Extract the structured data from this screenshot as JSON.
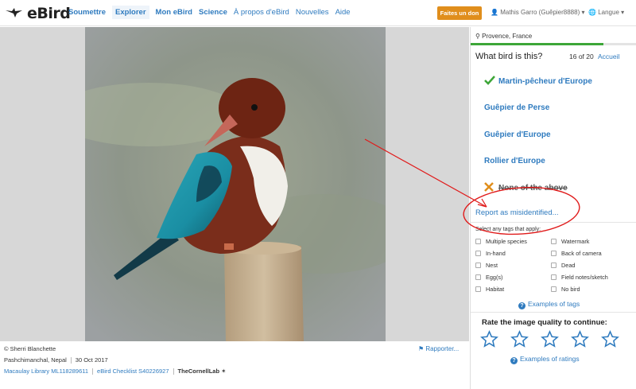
{
  "header": {
    "logo_text": "eBird",
    "nav": [
      "Soumettre",
      "Explorer",
      "Mon eBird",
      "Science",
      "À propos d'eBird",
      "Nouvelles",
      "Aide"
    ],
    "donate_label": "Faites un don",
    "user_label": "Mathis Garro (Guêpier8888)",
    "language_label": "Langue"
  },
  "photo": {
    "credit": "© Sherri Blanchette",
    "location": "Pashchimanchal, Nepal",
    "date": "30 Oct 2017",
    "catalog": "Macaulay Library ML118289611",
    "checklist": "eBird Checklist S40226927",
    "cornell": "TheCornellLab",
    "report_label": "Rapporter..."
  },
  "quiz": {
    "location": "Provence, France",
    "progress_fraction": 0.8,
    "question": "What bird is this?",
    "counter": "16 of 20",
    "home_label": "Accueil",
    "answers": [
      {
        "label": "Martin-pêcheur d'Europe",
        "mark": "check"
      },
      {
        "label": "Guêpier de Perse",
        "mark": ""
      },
      {
        "label": "Guêpier d'Europe",
        "mark": ""
      },
      {
        "label": "Rollier d'Europe",
        "mark": ""
      },
      {
        "label": "None of the above",
        "mark": "cross"
      }
    ],
    "misidentified_label": "Report as misidentified...",
    "tags_title": "Select any tags that apply:",
    "tags": [
      "Multiple species",
      "Watermark",
      "In-hand",
      "Back of camera",
      "Nest",
      "Dead",
      "Egg(s)",
      "Field notes/sketch",
      "Habitat",
      "No bird"
    ],
    "tags_examples": "Examples of tags",
    "rate_title": "Rate the image quality to continue:",
    "rating_examples": "Examples of ratings",
    "star_count": 5
  },
  "colors": {
    "link": "#2f7bbf",
    "donate": "#e08e1c",
    "progress": "#3da638",
    "annotation": "#e01b1b"
  }
}
